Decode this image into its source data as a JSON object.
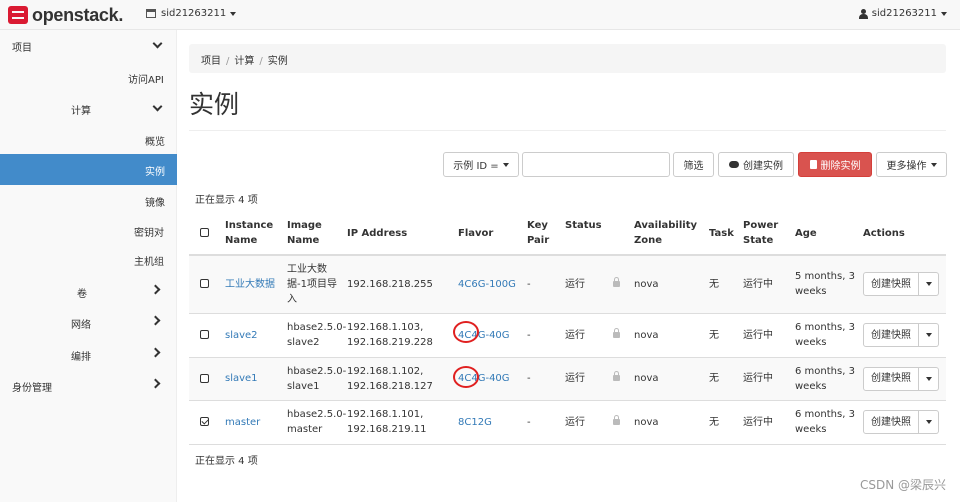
{
  "navbar": {
    "brand": "openstack.",
    "project": "sid21263211",
    "user": "sid21263211"
  },
  "sidebar": {
    "project": "项目",
    "api_access": "访问API",
    "compute": "计算",
    "overview": "概览",
    "instances": "实例",
    "images": "镜像",
    "key_pairs": "密钥对",
    "server_groups": "主机组",
    "volumes": "卷",
    "network": "网络",
    "orchestration": "编排",
    "identity": "身份管理"
  },
  "breadcrumb": [
    "项目",
    "计算",
    "实例"
  ],
  "page_title": "实例",
  "toolbar": {
    "filter_field": "示例 ID =",
    "filter_value": "",
    "filter_button": "筛选",
    "launch_button": "创建实例",
    "delete_button": "删除实例",
    "more_actions": "更多操作"
  },
  "count_top": "正在显示 4 项",
  "count_bottom": "正在显示 4 项",
  "table": {
    "headers": {
      "name": "Instance Name",
      "image": "Image Name",
      "ip": "IP Address",
      "flavor": "Flavor",
      "key_pair": "Key Pair",
      "status": "Status",
      "zone": "Availability Zone",
      "task": "Task",
      "power": "Power State",
      "age": "Age",
      "actions": "Actions"
    },
    "rows": [
      {
        "name": "工业大数据",
        "image": "工业大数据-1项目导入",
        "ip": "192.168.218.255",
        "flavor": "4C6G-100G",
        "key_pair": "-",
        "status": "运行",
        "zone": "nova",
        "task": "无",
        "power": "运行中",
        "age": "5 months, 3 weeks",
        "action": "创建快照",
        "checked": false
      },
      {
        "name": "slave2",
        "image": "hbase2.5.0-slave2",
        "ip": "192.168.1.103, 192.168.219.228",
        "flavor": "4C4G-40G",
        "key_pair": "-",
        "status": "运行",
        "zone": "nova",
        "task": "无",
        "power": "运行中",
        "age": "6 months, 3 weeks",
        "action": "创建快照",
        "checked": false
      },
      {
        "name": "slave1",
        "image": "hbase2.5.0-slave1",
        "ip": "192.168.1.102, 192.168.218.127",
        "flavor": "4C4G-40G",
        "key_pair": "-",
        "status": "运行",
        "zone": "nova",
        "task": "无",
        "power": "运行中",
        "age": "6 months, 3 weeks",
        "action": "创建快照",
        "checked": false
      },
      {
        "name": "master",
        "image": "hbase2.5.0-master",
        "ip": "192.168.1.101, 192.168.219.11",
        "flavor": "8C12G",
        "key_pair": "-",
        "status": "运行",
        "zone": "nova",
        "task": "无",
        "power": "运行中",
        "age": "6 months, 3 weeks",
        "action": "创建快照",
        "checked": true
      }
    ]
  },
  "watermark": "CSDN @梁辰兴"
}
